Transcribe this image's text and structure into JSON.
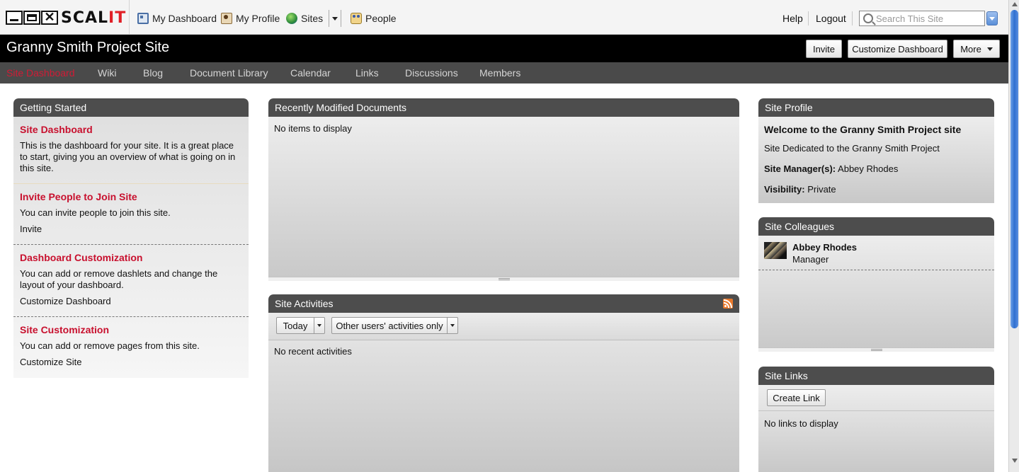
{
  "app": {
    "logo_text": "SCAL",
    "logo_text_accent": "IT",
    "nav": {
      "my_dashboard": "My Dashboard",
      "my_profile": "My Profile",
      "sites": "Sites",
      "people": "People"
    },
    "help": "Help",
    "logout": "Logout",
    "search": {
      "placeholder": "Search This Site"
    }
  },
  "site": {
    "title": "Granny Smith Project Site",
    "buttons": {
      "invite": "Invite",
      "customize_dashboard": "Customize Dashboard",
      "more": "More"
    }
  },
  "page_nav": {
    "site_dashboard": "Site Dashboard",
    "wiki": "Wiki",
    "blog": "Blog",
    "document_library": "Document Library",
    "calendar": "Calendar",
    "links": "Links",
    "discussions": "Discussions",
    "members": "Members"
  },
  "getting_started": {
    "title": "Getting Started",
    "sections": [
      {
        "title": "Site Dashboard",
        "desc": "This is the dashboard for your site. It is a great place to start, giving you an overview of what is going on in this site."
      },
      {
        "title": "Invite People to Join Site",
        "desc": "You can invite people to join this site.",
        "action": "Invite"
      },
      {
        "title": "Dashboard Customization",
        "desc": "You can add or remove dashlets and change the layout of your dashboard.",
        "action": "Customize Dashboard"
      },
      {
        "title": "Site Customization",
        "desc": "You can add or remove pages from this site.",
        "action": "Customize Site"
      }
    ]
  },
  "recent_docs": {
    "title": "Recently Modified Documents",
    "empty": "No items to display"
  },
  "site_activities": {
    "title": "Site Activities",
    "filter_date": "Today",
    "filter_users": "Other users' activities only",
    "empty": "No recent activities"
  },
  "site_profile": {
    "title": "Site Profile",
    "welcome": "Welcome to the Granny Smith Project site",
    "description": "Site Dedicated to the Granny Smith Project",
    "manager_label": "Site Manager(s):",
    "manager_value": "Abbey Rhodes",
    "visibility_label": "Visibility:",
    "visibility_value": "Private"
  },
  "site_colleagues": {
    "title": "Site Colleagues",
    "members": [
      {
        "name": "Abbey Rhodes",
        "role": "Manager"
      }
    ]
  },
  "site_links": {
    "title": "Site Links",
    "create_button": "Create Link",
    "empty": "No links to display"
  },
  "colors": {
    "accent_red": "#c8102e",
    "header_dark": "#4d4d4d",
    "title_bar": "#000000"
  }
}
